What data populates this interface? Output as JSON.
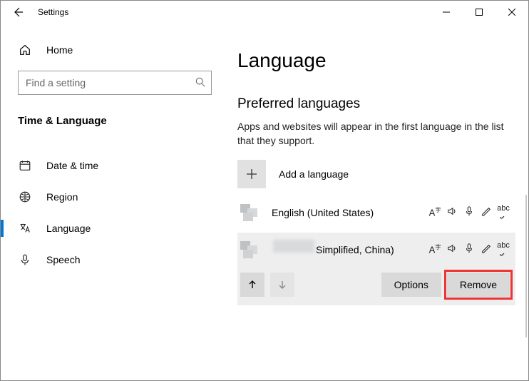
{
  "window": {
    "title": "Settings"
  },
  "sidebar": {
    "home": "Home",
    "search_placeholder": "Find a setting",
    "category": "Time & Language",
    "items": [
      {
        "label": "Date & time"
      },
      {
        "label": "Region"
      },
      {
        "label": "Language"
      },
      {
        "label": "Speech"
      }
    ]
  },
  "main": {
    "page_title": "Language",
    "section_title": "Preferred languages",
    "section_desc": "Apps and websites will appear in the first language in the list that they support.",
    "add_language": "Add a language",
    "languages": [
      {
        "name": "English (United States)"
      },
      {
        "name": "Simplified, China)"
      }
    ],
    "options_label": "Options",
    "remove_label": "Remove"
  }
}
